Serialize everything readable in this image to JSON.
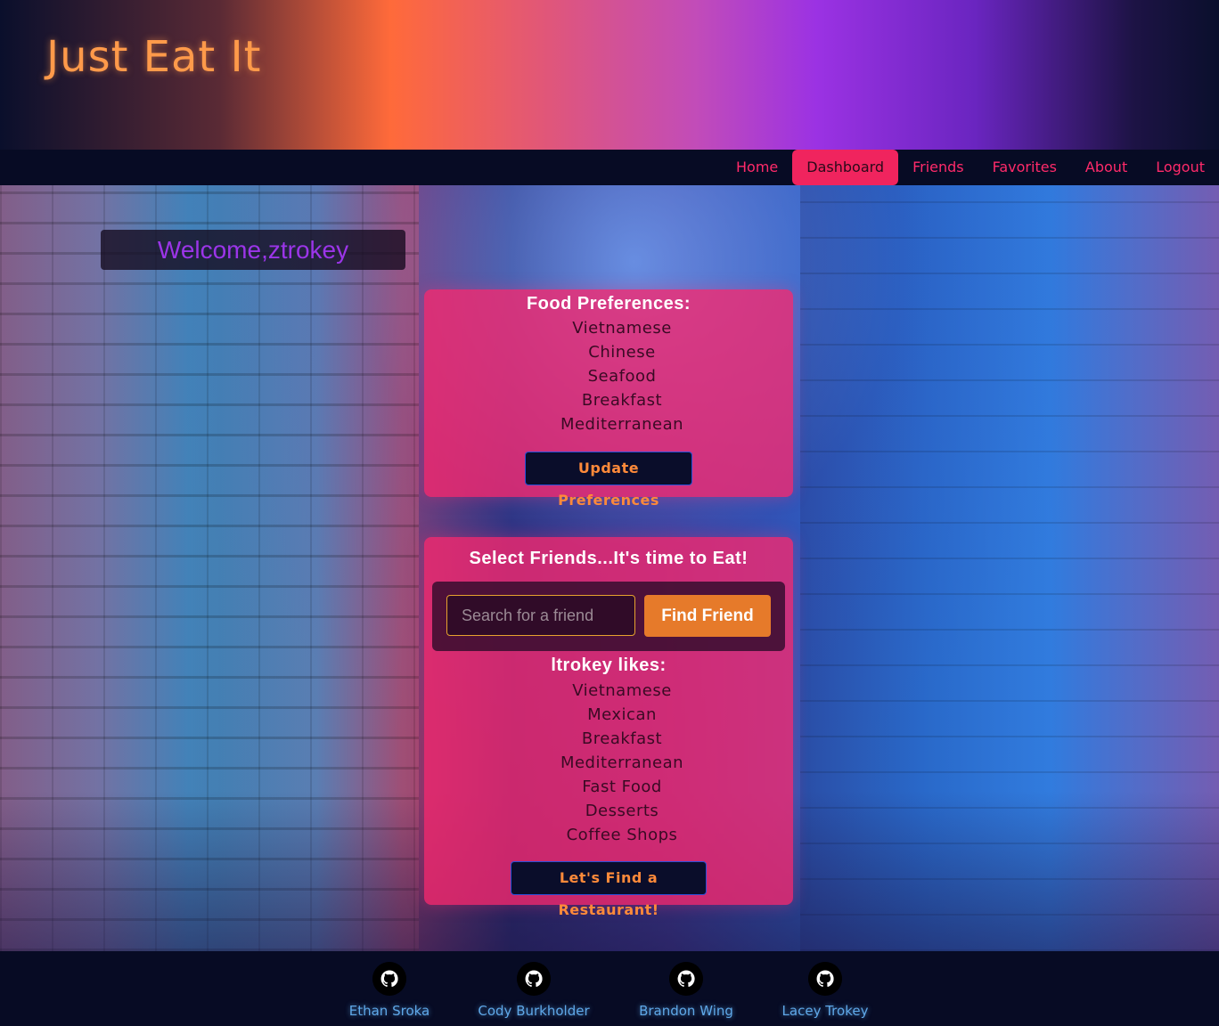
{
  "header": {
    "title": "Just Eat It"
  },
  "nav": {
    "items": [
      {
        "label": "Home",
        "active": false
      },
      {
        "label": "Dashboard",
        "active": true
      },
      {
        "label": "Friends",
        "active": false
      },
      {
        "label": "Favorites",
        "active": false
      },
      {
        "label": "About",
        "active": false
      },
      {
        "label": "Logout",
        "active": false
      }
    ]
  },
  "welcome": {
    "text": "Welcome,ztrokey"
  },
  "preferences": {
    "title": "Food Preferences:",
    "items": [
      "Vietnamese",
      "Chinese",
      "Seafood",
      "Breakfast",
      "Mediterranean"
    ],
    "button_label": "Update Preferences"
  },
  "friends": {
    "title": "Select Friends...It's time to Eat!",
    "search_placeholder": "Search for a friend",
    "search_value": "",
    "find_button_label": "Find Friend",
    "likes_title": "ltrokey likes:",
    "likes": [
      "Vietnamese",
      "Mexican",
      "Breakfast",
      "Mediterranean",
      "Fast Food",
      "Desserts",
      "Coffee Shops"
    ],
    "restaurant_button_label": "Let's Find a Restaurant!"
  },
  "footer": {
    "contributors": [
      {
        "name": "Ethan Sroka",
        "icon": "github-icon"
      },
      {
        "name": "Cody Burkholder",
        "icon": "github-icon"
      },
      {
        "name": "Brandon Wing",
        "icon": "github-icon"
      },
      {
        "name": "Lacey Trokey",
        "icon": "github-icon"
      }
    ]
  },
  "colors": {
    "accent_pink": "#f0245e",
    "card_pink": "#f8286e",
    "title_orange": "#ff9a4a",
    "welcome_purple": "#9b35e8",
    "button_orange": "#e67a2a",
    "footer_link_blue": "#5fa8e8",
    "dark_navy": "#070b24"
  }
}
